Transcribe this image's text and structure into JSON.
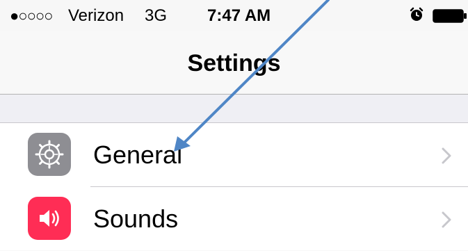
{
  "status_bar": {
    "signal": "●○○○○",
    "carrier": "Verizon",
    "network": "3G",
    "time": "7:47 AM",
    "alarm_icon": "alarm-clock-icon",
    "battery_icon": "battery-icon"
  },
  "nav": {
    "title": "Settings"
  },
  "settings": {
    "items": [
      {
        "label": "General",
        "icon": "gear-icon",
        "icon_color": "#8e8e93"
      },
      {
        "label": "Sounds",
        "icon": "speaker-icon",
        "icon_color": "#ff2d55"
      }
    ]
  },
  "colors": {
    "arrow": "#4f86c6",
    "group_background": "#efeff4",
    "chevron": "#c7c7cc"
  }
}
